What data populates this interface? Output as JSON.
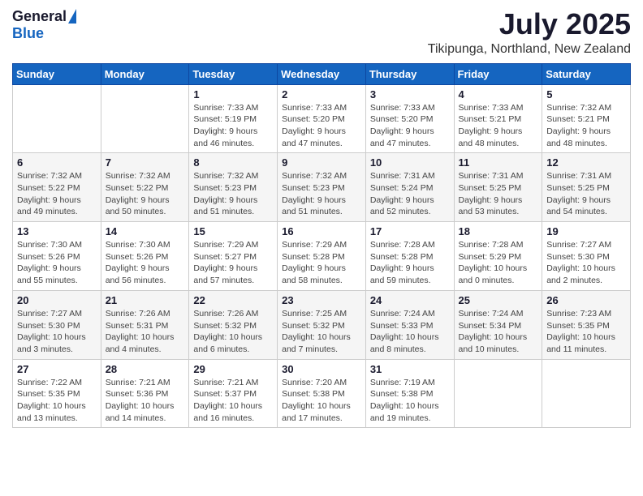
{
  "logo": {
    "general": "General",
    "blue": "Blue"
  },
  "title": {
    "month_year": "July 2025",
    "location": "Tikipunga, Northland, New Zealand"
  },
  "days_of_week": [
    "Sunday",
    "Monday",
    "Tuesday",
    "Wednesday",
    "Thursday",
    "Friday",
    "Saturday"
  ],
  "weeks": [
    [
      {
        "day": "",
        "detail": ""
      },
      {
        "day": "",
        "detail": ""
      },
      {
        "day": "1",
        "detail": "Sunrise: 7:33 AM\nSunset: 5:19 PM\nDaylight: 9 hours and 46 minutes."
      },
      {
        "day": "2",
        "detail": "Sunrise: 7:33 AM\nSunset: 5:20 PM\nDaylight: 9 hours and 47 minutes."
      },
      {
        "day": "3",
        "detail": "Sunrise: 7:33 AM\nSunset: 5:20 PM\nDaylight: 9 hours and 47 minutes."
      },
      {
        "day": "4",
        "detail": "Sunrise: 7:33 AM\nSunset: 5:21 PM\nDaylight: 9 hours and 48 minutes."
      },
      {
        "day": "5",
        "detail": "Sunrise: 7:32 AM\nSunset: 5:21 PM\nDaylight: 9 hours and 48 minutes."
      }
    ],
    [
      {
        "day": "6",
        "detail": "Sunrise: 7:32 AM\nSunset: 5:22 PM\nDaylight: 9 hours and 49 minutes."
      },
      {
        "day": "7",
        "detail": "Sunrise: 7:32 AM\nSunset: 5:22 PM\nDaylight: 9 hours and 50 minutes."
      },
      {
        "day": "8",
        "detail": "Sunrise: 7:32 AM\nSunset: 5:23 PM\nDaylight: 9 hours and 51 minutes."
      },
      {
        "day": "9",
        "detail": "Sunrise: 7:32 AM\nSunset: 5:23 PM\nDaylight: 9 hours and 51 minutes."
      },
      {
        "day": "10",
        "detail": "Sunrise: 7:31 AM\nSunset: 5:24 PM\nDaylight: 9 hours and 52 minutes."
      },
      {
        "day": "11",
        "detail": "Sunrise: 7:31 AM\nSunset: 5:25 PM\nDaylight: 9 hours and 53 minutes."
      },
      {
        "day": "12",
        "detail": "Sunrise: 7:31 AM\nSunset: 5:25 PM\nDaylight: 9 hours and 54 minutes."
      }
    ],
    [
      {
        "day": "13",
        "detail": "Sunrise: 7:30 AM\nSunset: 5:26 PM\nDaylight: 9 hours and 55 minutes."
      },
      {
        "day": "14",
        "detail": "Sunrise: 7:30 AM\nSunset: 5:26 PM\nDaylight: 9 hours and 56 minutes."
      },
      {
        "day": "15",
        "detail": "Sunrise: 7:29 AM\nSunset: 5:27 PM\nDaylight: 9 hours and 57 minutes."
      },
      {
        "day": "16",
        "detail": "Sunrise: 7:29 AM\nSunset: 5:28 PM\nDaylight: 9 hours and 58 minutes."
      },
      {
        "day": "17",
        "detail": "Sunrise: 7:28 AM\nSunset: 5:28 PM\nDaylight: 9 hours and 59 minutes."
      },
      {
        "day": "18",
        "detail": "Sunrise: 7:28 AM\nSunset: 5:29 PM\nDaylight: 10 hours and 0 minutes."
      },
      {
        "day": "19",
        "detail": "Sunrise: 7:27 AM\nSunset: 5:30 PM\nDaylight: 10 hours and 2 minutes."
      }
    ],
    [
      {
        "day": "20",
        "detail": "Sunrise: 7:27 AM\nSunset: 5:30 PM\nDaylight: 10 hours and 3 minutes."
      },
      {
        "day": "21",
        "detail": "Sunrise: 7:26 AM\nSunset: 5:31 PM\nDaylight: 10 hours and 4 minutes."
      },
      {
        "day": "22",
        "detail": "Sunrise: 7:26 AM\nSunset: 5:32 PM\nDaylight: 10 hours and 6 minutes."
      },
      {
        "day": "23",
        "detail": "Sunrise: 7:25 AM\nSunset: 5:32 PM\nDaylight: 10 hours and 7 minutes."
      },
      {
        "day": "24",
        "detail": "Sunrise: 7:24 AM\nSunset: 5:33 PM\nDaylight: 10 hours and 8 minutes."
      },
      {
        "day": "25",
        "detail": "Sunrise: 7:24 AM\nSunset: 5:34 PM\nDaylight: 10 hours and 10 minutes."
      },
      {
        "day": "26",
        "detail": "Sunrise: 7:23 AM\nSunset: 5:35 PM\nDaylight: 10 hours and 11 minutes."
      }
    ],
    [
      {
        "day": "27",
        "detail": "Sunrise: 7:22 AM\nSunset: 5:35 PM\nDaylight: 10 hours and 13 minutes."
      },
      {
        "day": "28",
        "detail": "Sunrise: 7:21 AM\nSunset: 5:36 PM\nDaylight: 10 hours and 14 minutes."
      },
      {
        "day": "29",
        "detail": "Sunrise: 7:21 AM\nSunset: 5:37 PM\nDaylight: 10 hours and 16 minutes."
      },
      {
        "day": "30",
        "detail": "Sunrise: 7:20 AM\nSunset: 5:38 PM\nDaylight: 10 hours and 17 minutes."
      },
      {
        "day": "31",
        "detail": "Sunrise: 7:19 AM\nSunset: 5:38 PM\nDaylight: 10 hours and 19 minutes."
      },
      {
        "day": "",
        "detail": ""
      },
      {
        "day": "",
        "detail": ""
      }
    ]
  ]
}
